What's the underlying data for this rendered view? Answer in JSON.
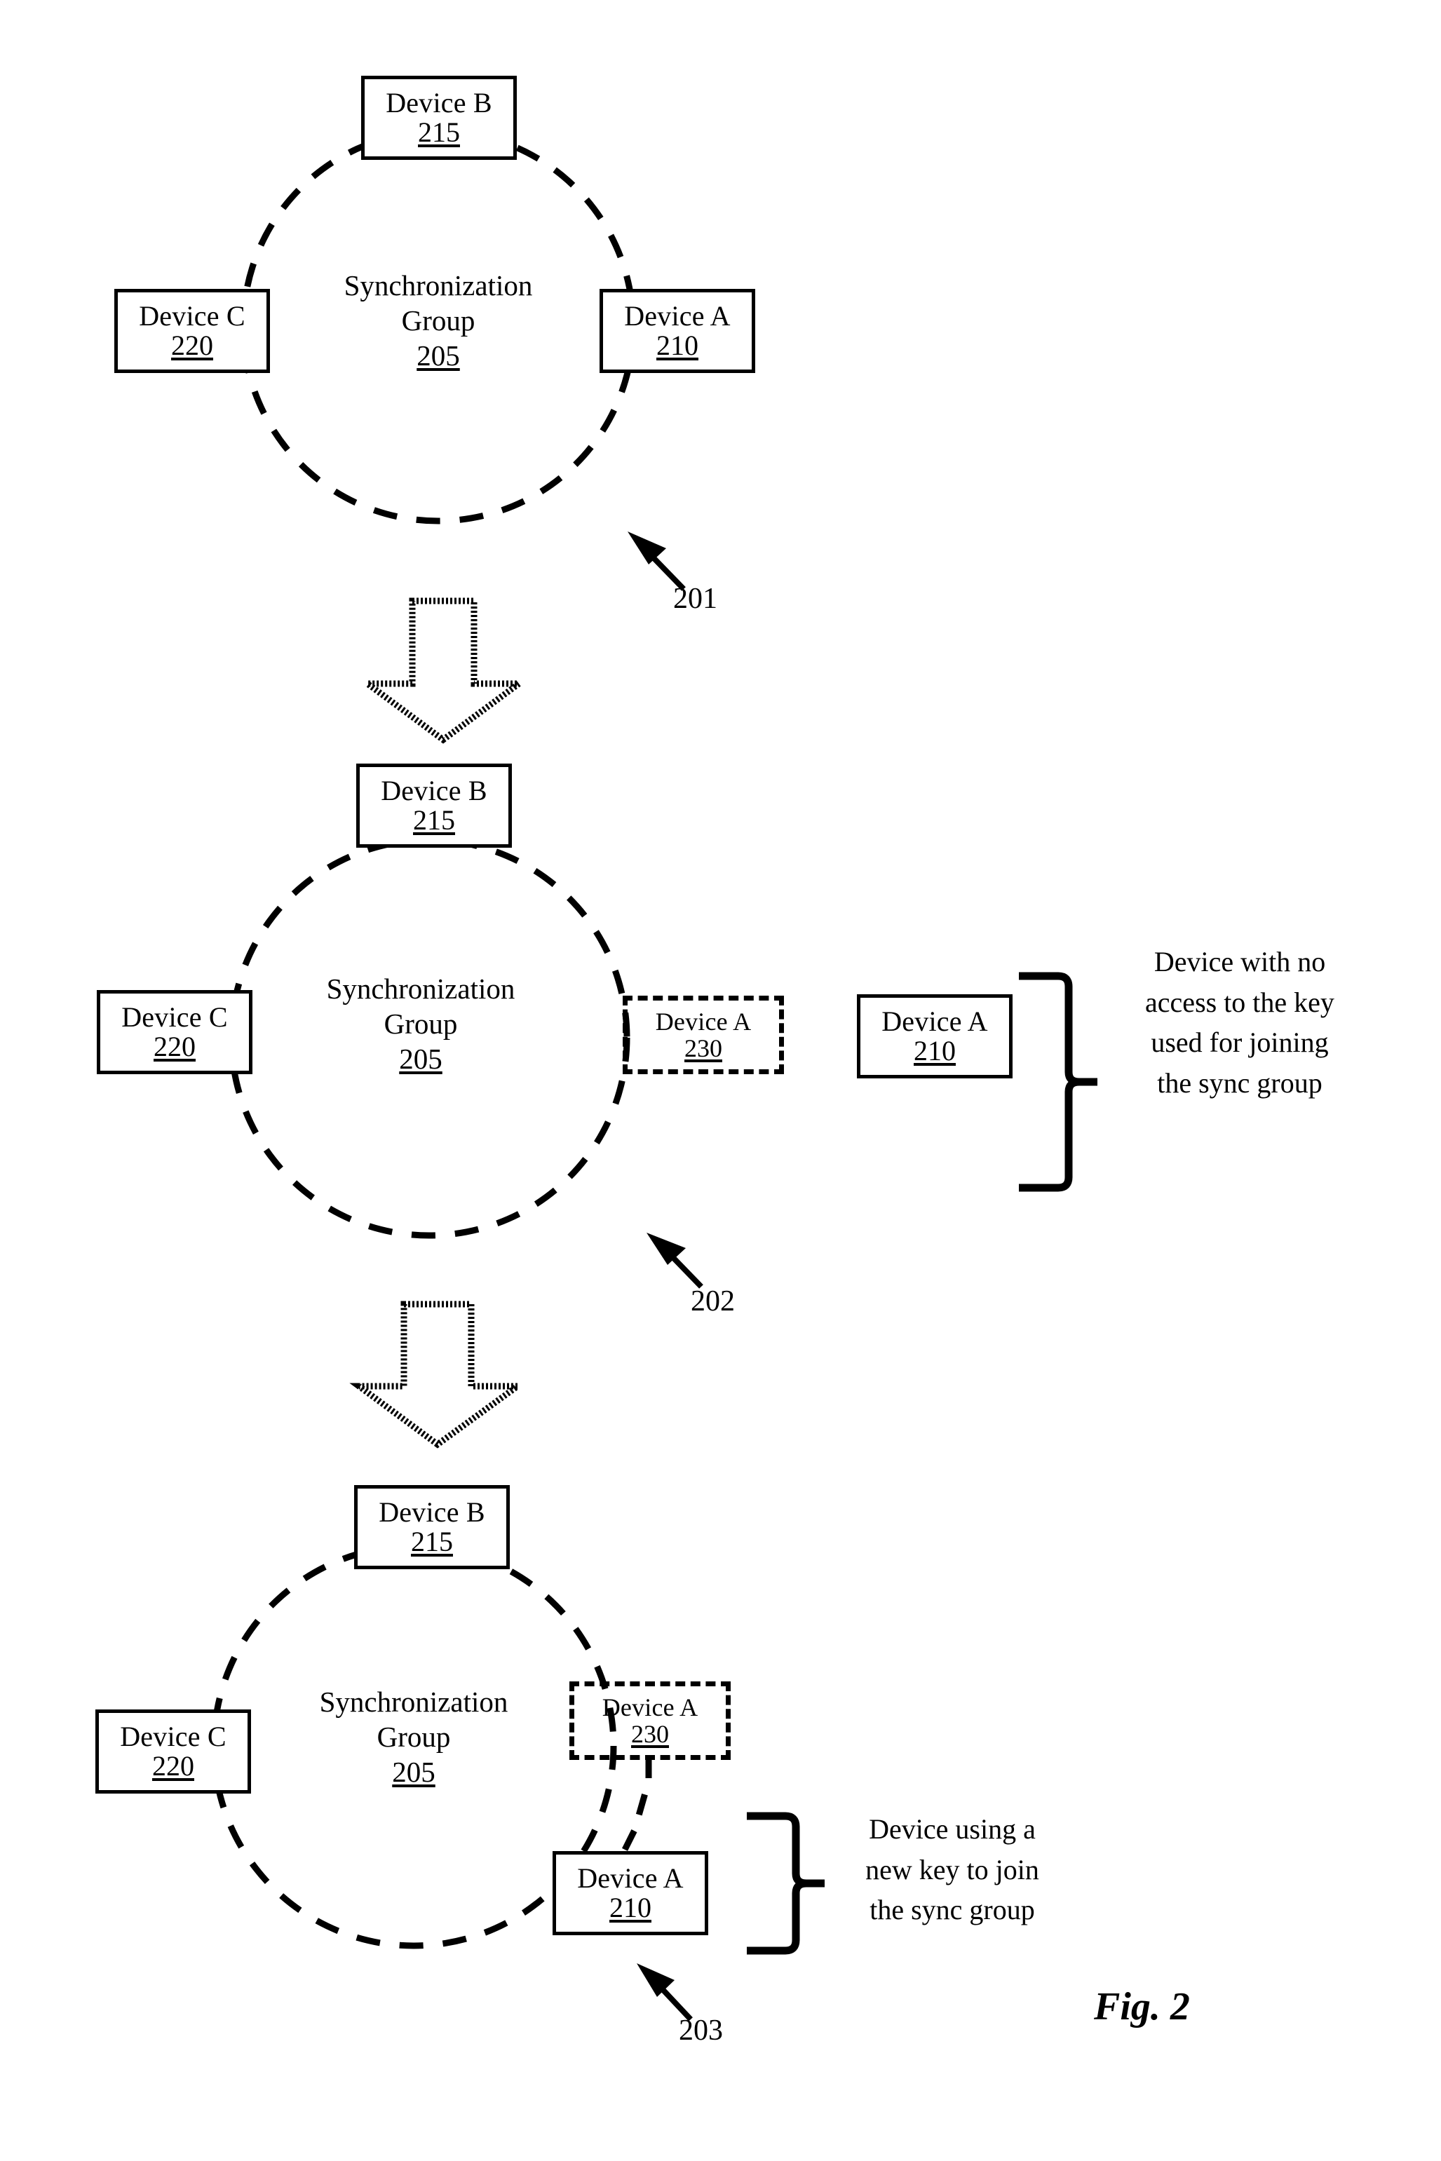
{
  "figure": {
    "label": "Fig. 2"
  },
  "panels": [
    {
      "id": "panel-201",
      "ref": "201",
      "group_caption": {
        "line1": "Synchronization",
        "line2": "Group",
        "number": "205"
      },
      "devices": [
        {
          "key": "device-b",
          "name": "Device B",
          "number": "215",
          "style": "solid"
        },
        {
          "key": "device-c",
          "name": "Device C",
          "number": "220",
          "style": "solid"
        },
        {
          "key": "device-a",
          "name": "Device A",
          "number": "210",
          "style": "solid"
        }
      ]
    },
    {
      "id": "panel-202",
      "ref": "202",
      "group_caption": {
        "line1": "Synchronization",
        "line2": "Group",
        "number": "205"
      },
      "devices": [
        {
          "key": "device-b",
          "name": "Device B",
          "number": "215",
          "style": "solid"
        },
        {
          "key": "device-c",
          "name": "Device C",
          "number": "220",
          "style": "solid"
        },
        {
          "key": "device-a-ghost",
          "name": "Device A",
          "number": "230",
          "style": "dashed"
        },
        {
          "key": "device-a-outside",
          "name": "Device A",
          "number": "210",
          "style": "solid"
        }
      ],
      "annotation": {
        "lines": [
          "Device with no",
          "access to the key",
          "used for joining",
          "the sync group"
        ]
      }
    },
    {
      "id": "panel-203",
      "ref": "203",
      "group_caption": {
        "line1": "Synchronization",
        "line2": "Group",
        "number": "205"
      },
      "devices": [
        {
          "key": "device-b",
          "name": "Device B",
          "number": "215",
          "style": "solid"
        },
        {
          "key": "device-c",
          "name": "Device C",
          "number": "220",
          "style": "solid"
        },
        {
          "key": "device-a-ghost",
          "name": "Device A",
          "number": "230",
          "style": "dashed"
        },
        {
          "key": "device-a-joined",
          "name": "Device A",
          "number": "210",
          "style": "solid"
        }
      ],
      "annotation": {
        "lines": [
          "Device using a",
          "new key to join",
          "the sync group"
        ]
      }
    }
  ],
  "icons": {
    "transition_arrow": "block-down-arrow",
    "pointer_arrow": "leader-arrow",
    "brace": "right-curly-brace"
  },
  "colors": {
    "stroke": "#000000",
    "background": "#ffffff"
  }
}
